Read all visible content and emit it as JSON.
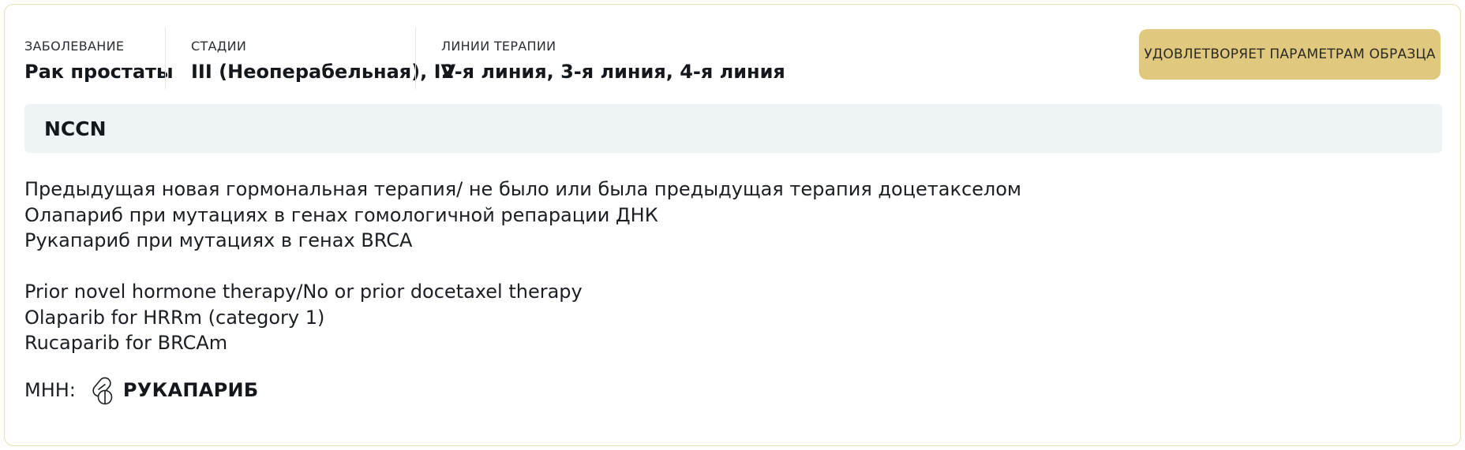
{
  "card": {
    "disease": {
      "label": "ЗАБОЛЕВАНИЕ",
      "value": "Рак простаты"
    },
    "stages": {
      "label": "СТАДИИ",
      "value": "III (Неоперабельная), IV"
    },
    "therapy_lines": {
      "label": "ЛИНИИ ТЕРАПИИ",
      "value": "2-я линия, 3-я линия, 4-я линия"
    },
    "badge": "УДОВЛЕТВОРЯЕТ ПАРАМЕТРАМ ОБРАЗЦА",
    "guideline": "NCCN",
    "description_ru": [
      "Предыдущая новая гормональная терапия/ не было или была предыдущая терапия доцетакселом",
      "Олапариб при мутациях в генах гомологичной репарации ДНК",
      "Рукапариб при мутациях в генах BRCA"
    ],
    "description_en": [
      "Prior novel hormone therapy/No or  prior docetaxel therapy",
      "Olaparib for HRRm (category 1)",
      "Rucaparib for BRCAm"
    ],
    "inn": {
      "label": "МНН:",
      "icon": "pills-icon",
      "drug": "РУКАПАРИБ"
    }
  },
  "colors": {
    "card_border": "#e8dfb0",
    "badge_bg": "#e0c97f",
    "guide_bar_bg": "#eef3f5",
    "text": "#1b1f24"
  }
}
